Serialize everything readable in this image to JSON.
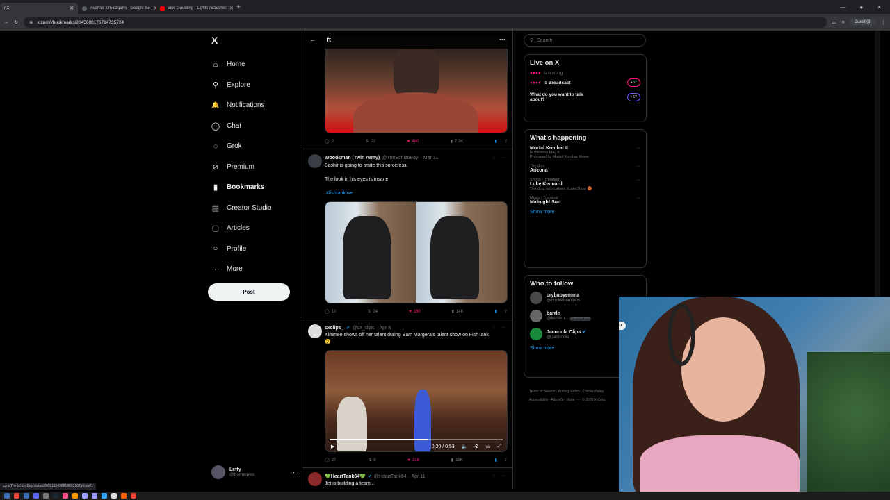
{
  "browser": {
    "tabs": [
      {
        "label": "/ X",
        "active": true
      },
      {
        "label": "invarlier xlm ozgami - Google Se",
        "active": false
      },
      {
        "label": "Ellie Goulding - Lights (Bassnec",
        "active": false
      }
    ],
    "url": "x.com/i/bookmarks/2045690176714735724",
    "guest_label": "Guest (3)",
    "status_url": "com/TheSchizoBoy/status/2039115436818693167/photo/1"
  },
  "sidebar": {
    "logo": "X",
    "items": [
      {
        "label": "Home",
        "icon": "home-icon",
        "glyph": "⌂"
      },
      {
        "label": "Explore",
        "icon": "search-icon",
        "glyph": "⚲"
      },
      {
        "label": "Notifications",
        "icon": "bell-icon",
        "glyph": "🔔"
      },
      {
        "label": "Chat",
        "icon": "chat-icon",
        "glyph": "◯"
      },
      {
        "label": "Grok",
        "icon": "grok-icon",
        "glyph": "◌"
      },
      {
        "label": "Premium",
        "icon": "premium-icon",
        "glyph": "⊘"
      },
      {
        "label": "Bookmarks",
        "icon": "bookmark-icon",
        "glyph": "▮"
      },
      {
        "label": "Creator Studio",
        "icon": "creator-studio-icon",
        "glyph": "▤"
      },
      {
        "label": "Articles",
        "icon": "articles-icon",
        "glyph": "▢"
      },
      {
        "label": "Profile",
        "icon": "profile-icon",
        "glyph": "○"
      },
      {
        "label": "More",
        "icon": "more-icon",
        "glyph": "⋯"
      }
    ],
    "post_label": "Post",
    "account": {
      "name": "Letty",
      "handle": "@bomtopiss",
      "more": "···"
    }
  },
  "feed": {
    "header_title": "ft",
    "tweets": [
      {
        "actions": {
          "replies": "2",
          "retweets": "22",
          "likes": "480",
          "views": "7.3K"
        }
      },
      {
        "name": "Woodsman (Twin Army)",
        "handle": "@TheSchizoBoy",
        "date": "· Mar 31",
        "lines": [
          "Bashir is going to smite this sorceress.",
          "The look in his eyes is insane"
        ],
        "hashtag": "#fishtanklive",
        "actions": {
          "replies": "10",
          "retweets": "24",
          "likes": "180",
          "views": "14K"
        }
      },
      {
        "name": "cxclips_",
        "handle": "@cx_clips",
        "date": "· Apr 8",
        "lines": [
          "Kimmee shows off her talent during Bam Margera's talent show on FishTank",
          "😲"
        ],
        "video_time": "0:30 / 0:53",
        "actions": {
          "replies": "27",
          "retweets": "8",
          "likes": "218",
          "views": "19K"
        }
      },
      {
        "name": "💚HeartTank64💚",
        "handle": "@HeartTank64",
        "date": "· Apr 11",
        "lines": [
          "Jet is building a team..."
        ]
      }
    ]
  },
  "right": {
    "search_placeholder": "Search",
    "live": {
      "title": "Live on X",
      "hosting": "is hosting",
      "broadcast": "'s Broadcast",
      "broadcast_count": "+37",
      "talk": "What do you want to talk about?",
      "talk_count": "+67"
    },
    "happening": {
      "title": "What’s happening",
      "trends": [
        {
          "category": "",
          "title": "Mortal Kombat II",
          "sub": "In theaters May 8",
          "sub2": "Promoted by Mortal Kombat Movie"
        },
        {
          "category": "Trending",
          "title": "Arizona",
          "sub": "",
          "sub2": ""
        },
        {
          "category": "Sports · Trending",
          "title": "Luke Kennard",
          "sub": "Trending with Lakers #LakeShow 🏀",
          "sub2": ""
        },
        {
          "category": "Music · Trending",
          "title": "Midnight Sun",
          "sub": "",
          "sub2": ""
        }
      ],
      "show_more": "Show more"
    },
    "who_to_follow": {
      "title": "Who to follow",
      "users": [
        {
          "name": "crybabyemma",
          "handle": "@cricketdan1els"
        },
        {
          "name": "barrle",
          "handle": "@itsbarri...",
          "badge": "Follows you"
        },
        {
          "name": "Jacooola Clips",
          "handle": "@Jacooola"
        }
      ],
      "follow_label": "Follo",
      "show_more": "Show more"
    },
    "footer": [
      "Terms of Service",
      "Privacy Policy",
      "Cookie Policy",
      "Accessibility",
      "Ads info",
      "More ···",
      "© 2026 X Corp."
    ]
  },
  "colors": {
    "accent": "#1d9bf0",
    "like": "#f91880",
    "bg": "#000000",
    "border": "#2f3336"
  }
}
